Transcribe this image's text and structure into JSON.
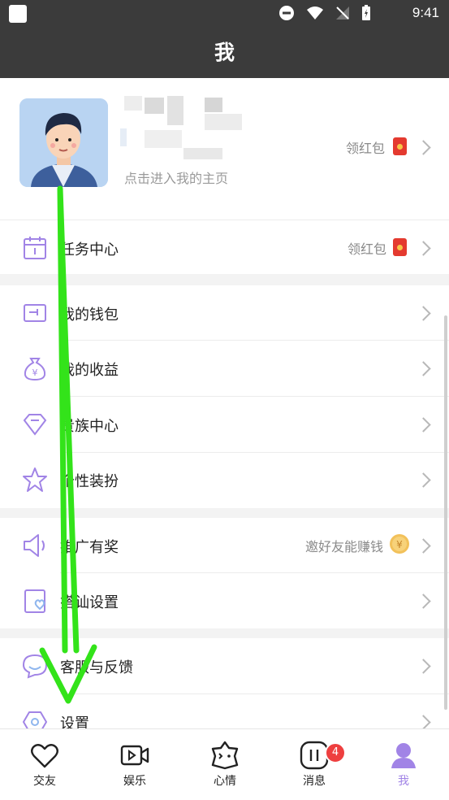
{
  "status": {
    "time": "9:41"
  },
  "header": {
    "title": "我"
  },
  "profile": {
    "subtitle": "点击进入我的主页",
    "hint": "领红包"
  },
  "menu": {
    "task": {
      "label": "任务中心",
      "hint": "领红包"
    },
    "wallet": {
      "label": "我的钱包"
    },
    "income": {
      "label": "我的收益"
    },
    "noble": {
      "label": "贵族中心"
    },
    "dressup": {
      "label": "个性装扮"
    },
    "promote": {
      "label": "推广有奖",
      "hint": "邀好友能赚钱",
      "coin": "¥"
    },
    "chatup": {
      "label": "搭讪设置"
    },
    "service": {
      "label": "客服与反馈"
    },
    "settings": {
      "label": "设置"
    }
  },
  "tabbar": {
    "tabs": [
      {
        "label": "交友",
        "icon": "heart-icon"
      },
      {
        "label": "娱乐",
        "icon": "video-icon"
      },
      {
        "label": "心情",
        "icon": "mood-icon"
      },
      {
        "label": "消息",
        "icon": "pause-message-icon",
        "badge": "4"
      },
      {
        "label": "我",
        "icon": "user-icon"
      }
    ]
  },
  "colors": {
    "accent": "#a184e6",
    "headerBg": "#3b3b3b",
    "annotation": "#33e31a",
    "badge": "#ee3f3f"
  }
}
